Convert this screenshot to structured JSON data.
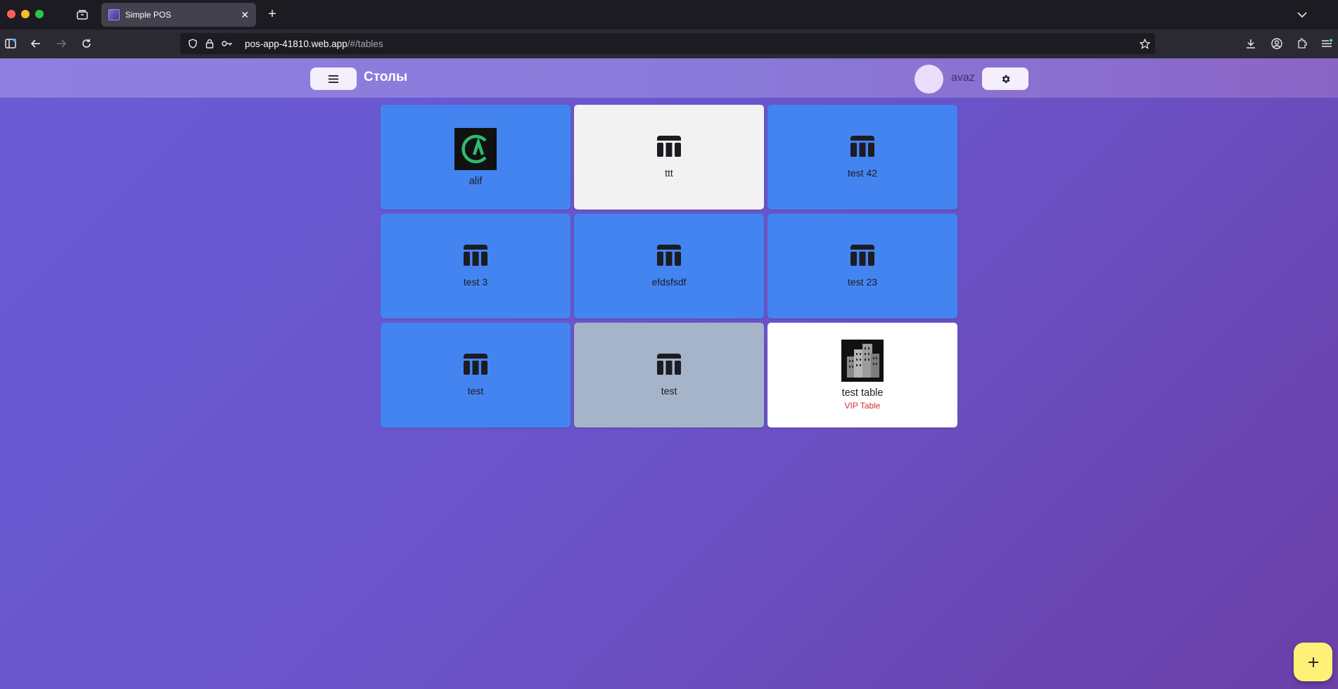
{
  "browser": {
    "tab_title": "Simple POS",
    "url_host": "pos-app-41810.web.app",
    "url_path": "/#/tables"
  },
  "appbar": {
    "title": "Столы",
    "username": "avaz"
  },
  "tables": [
    {
      "name": "alif",
      "subtitle": "",
      "style": "blue",
      "icon": "alif-logo-image"
    },
    {
      "name": "ttt",
      "subtitle": "",
      "style": "light",
      "icon": "table-icon"
    },
    {
      "name": "test 42",
      "subtitle": "",
      "style": "blue",
      "icon": "table-icon"
    },
    {
      "name": "test 3",
      "subtitle": "",
      "style": "blue",
      "icon": "table-icon"
    },
    {
      "name": "efdsfsdf",
      "subtitle": "",
      "style": "blue",
      "icon": "table-icon"
    },
    {
      "name": "test 23",
      "subtitle": "",
      "style": "blue",
      "icon": "table-icon"
    },
    {
      "name": "test",
      "subtitle": "",
      "style": "blue",
      "icon": "table-icon"
    },
    {
      "name": "test",
      "subtitle": "",
      "style": "grey",
      "icon": "table-icon"
    },
    {
      "name": "test table",
      "subtitle": "VIP Table",
      "style": "white",
      "icon": "buildings-image"
    }
  ],
  "colors": {
    "card_blue": "#4384f1",
    "vip_red": "#d32f2f",
    "fab_yellow": "#fff176"
  }
}
